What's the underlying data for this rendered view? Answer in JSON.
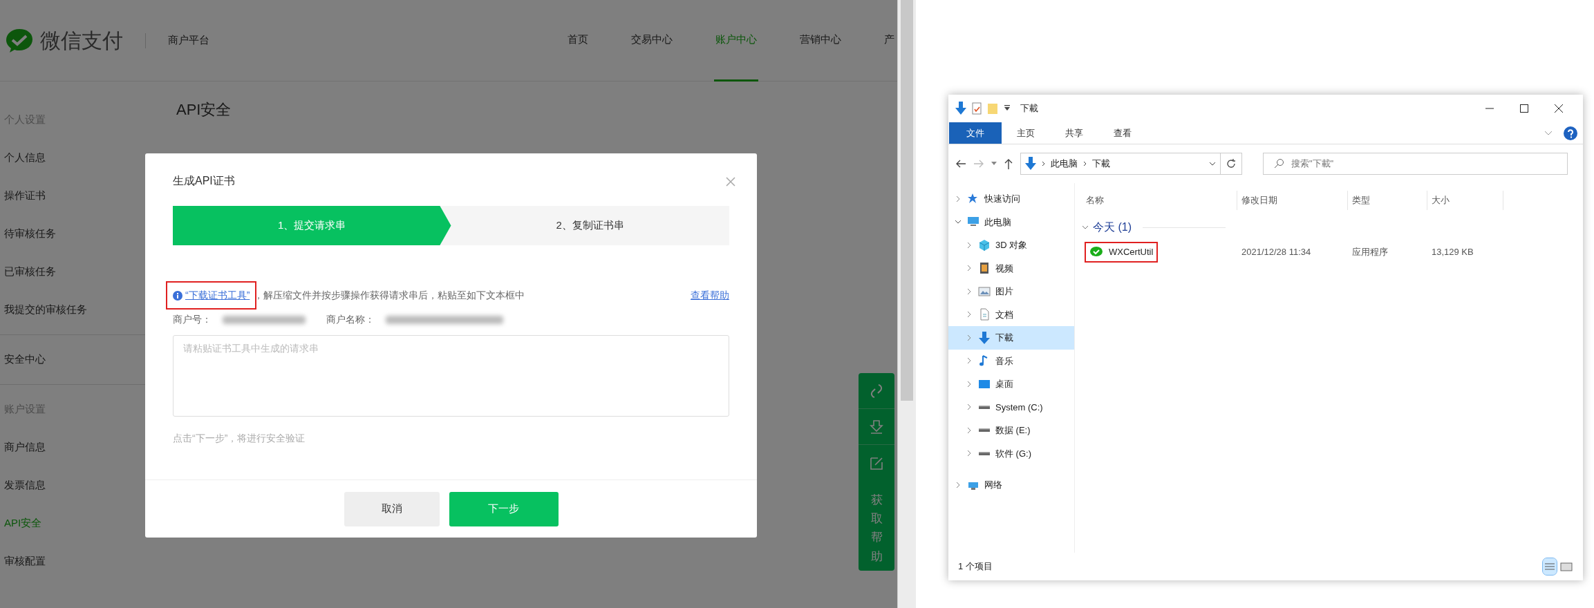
{
  "web_page": {
    "logo": {
      "text": "微信支付"
    },
    "platform": "商户平台",
    "nav": [
      {
        "label": "首页",
        "selected": false
      },
      {
        "label": "交易中心",
        "selected": false
      },
      {
        "label": "账户中心",
        "selected": true
      },
      {
        "label": "营销中心",
        "selected": false
      },
      {
        "label": "产",
        "selected": false
      }
    ],
    "sidebar_sections": [
      {
        "heading": "个人设置",
        "items": [
          {
            "label": "个人信息",
            "selected": false
          },
          {
            "label": "操作证书",
            "selected": false
          },
          {
            "label": "待审核任务",
            "selected": false
          },
          {
            "label": "已审核任务",
            "selected": false
          },
          {
            "label": "我提交的审核任务",
            "selected": false
          }
        ]
      },
      {
        "items": [
          {
            "label": "安全中心",
            "selected": false
          }
        ]
      },
      {
        "heading": "账户设置",
        "items": [
          {
            "label": "商户信息",
            "selected": false
          },
          {
            "label": "发票信息",
            "selected": false
          },
          {
            "label": "API安全",
            "selected": true
          },
          {
            "label": "审核配置",
            "selected": false
          }
        ]
      }
    ],
    "page_title": "API安全",
    "float_toolbar": {
      "label": "获取帮助"
    }
  },
  "dialog": {
    "title": "生成API证书",
    "steps": [
      {
        "label": "1、提交请求串",
        "selected": true
      },
      {
        "label": "2、复制证书串",
        "selected": false
      }
    ],
    "info": {
      "link": "“下载证书工具”",
      "text": "，解压缩文件并按步骤操作获得请求串后，粘贴至如下文本框中",
      "highlighted": true
    },
    "help_link": "查看帮助",
    "merchant_id": {
      "label": "商户号：",
      "redacted": true
    },
    "merchant_name": {
      "label": "商户名称：",
      "redacted": true
    },
    "textarea": {
      "placeholder": "请粘贴证书工具中生成的请求串"
    },
    "hint": "点击“下一步”，将进行安全验证",
    "buttons": [
      {
        "label": "取消",
        "kind": "secondary"
      },
      {
        "label": "下一步",
        "kind": "primary"
      }
    ]
  },
  "explorer": {
    "title": "下載",
    "ribbon_tabs": [
      {
        "label": "文件",
        "selected": true
      },
      {
        "label": "主页",
        "selected": false
      },
      {
        "label": "共享",
        "selected": false
      },
      {
        "label": "查看",
        "selected": false
      }
    ],
    "address": [
      "此电脑",
      "下載"
    ],
    "search": {
      "placeholder": "搜索\"下載\""
    },
    "nav_tree": [
      {
        "label": "快速访问",
        "kind": "star",
        "expanded": false,
        "selected": false
      },
      {
        "label": "此电脑",
        "kind": "computer",
        "expanded": true,
        "selected": false,
        "children": [
          {
            "label": "3D 对象",
            "kind": "cube",
            "expanded": false,
            "selected": false
          },
          {
            "label": "视频",
            "kind": "video",
            "expanded": false,
            "selected": false
          },
          {
            "label": "图片",
            "kind": "image",
            "expanded": false,
            "selected": false
          },
          {
            "label": "文档",
            "kind": "document",
            "expanded": false,
            "selected": false
          },
          {
            "label": "下載",
            "kind": "download",
            "expanded": false,
            "selected": true
          },
          {
            "label": "音乐",
            "kind": "music",
            "expanded": false,
            "selected": false
          },
          {
            "label": "桌面",
            "kind": "desktop",
            "expanded": false,
            "selected": false
          },
          {
            "label": "System (C:)",
            "kind": "drive",
            "expanded": false,
            "selected": false
          },
          {
            "label": "数据 (E:)",
            "kind": "drive",
            "expanded": false,
            "selected": false
          },
          {
            "label": "软件 (G:)",
            "kind": "drive",
            "expanded": false,
            "selected": false
          }
        ]
      },
      {
        "label": "网络",
        "kind": "network",
        "expanded": false,
        "selected": false
      }
    ],
    "columns": [
      "名称",
      "修改日期",
      "类型",
      "大小"
    ],
    "groups": [
      {
        "label": "今天 (1)",
        "expanded": true,
        "files": [
          {
            "name": "WXCertUtil",
            "modified": "2021/12/28 11:34",
            "type": "应用程序",
            "size": "13,129 KB",
            "highlighted": true
          }
        ]
      }
    ],
    "status": "1 个项目"
  }
}
